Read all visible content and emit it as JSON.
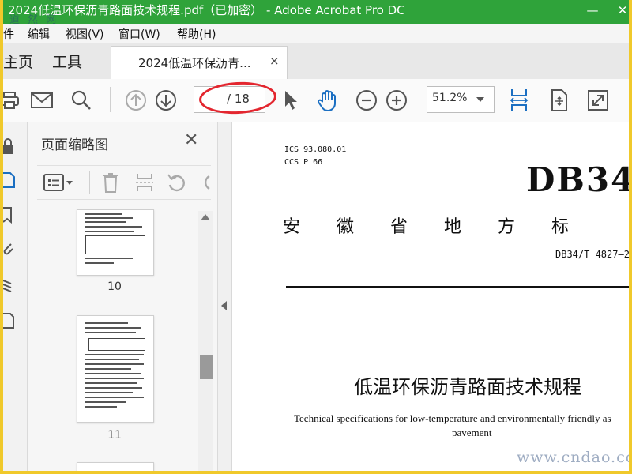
{
  "window": {
    "title": "2024低温环保沥青路面技术规程.pdf（已加密） - Adobe Acrobat Pro DC",
    "minimize": "—",
    "close": "✕"
  },
  "menu": [
    "件",
    "编辑",
    "视图(V)",
    "窗口(W)",
    "帮助(H)"
  ],
  "watermark_top": "道 然 网",
  "tabs": {
    "home": "主页",
    "tools": "工具",
    "doc_tab": "2024低温环保沥青...",
    "doc_close": "×"
  },
  "toolbar": {
    "page_current": "",
    "page_total": "/ 18",
    "zoom": "51.2%"
  },
  "thumbnails_panel": {
    "title": "页面缩略图",
    "close": "✕",
    "pages": [
      {
        "label": "10"
      },
      {
        "label": "11"
      }
    ]
  },
  "document": {
    "ics": "ICS  93.080.01",
    "ccs": "CCS  P 66",
    "db_code": "DB34",
    "province": "安徽省地方标",
    "std_number": "DB34/T 4827—2",
    "title_cn": "低温环保沥青路面技术规程",
    "title_en_line1": "Technical specifications for low-temperature and environmentally friendly as",
    "title_en_line2": "pavement"
  },
  "watermark_bottom": "www.cndao.com"
}
